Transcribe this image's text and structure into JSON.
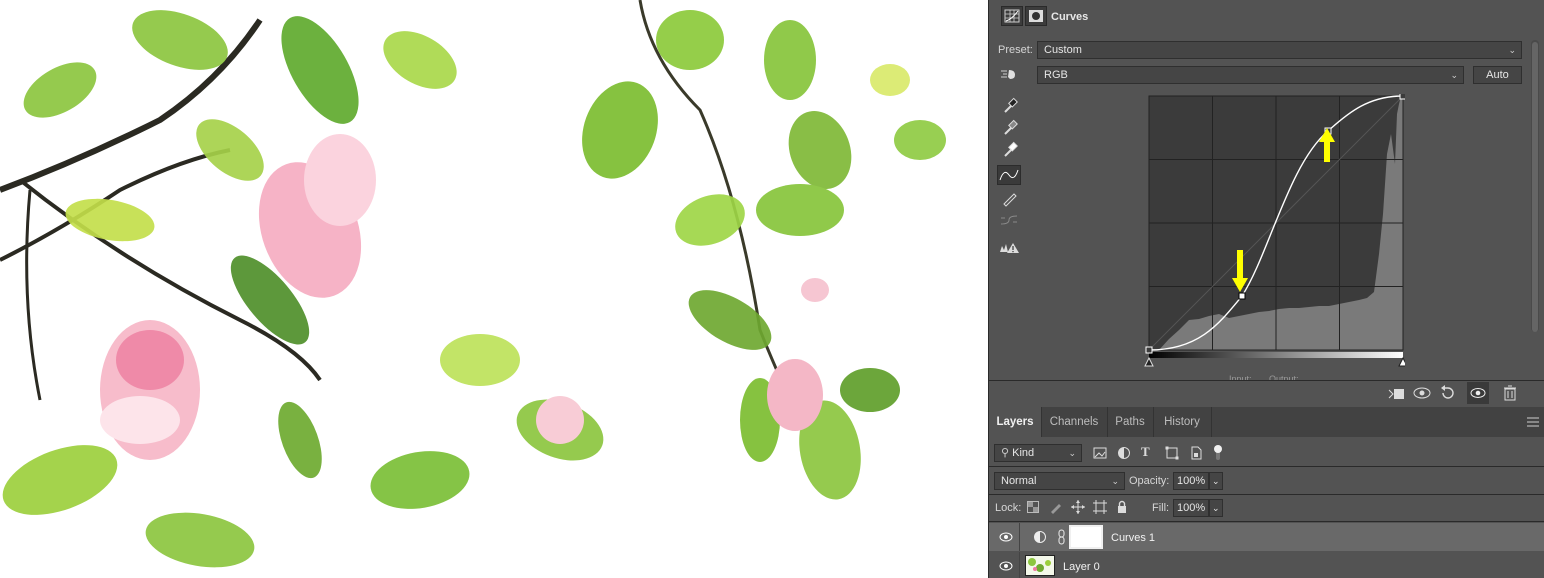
{
  "photo": {
    "subject": ""
  },
  "properties": {
    "title": "Curves",
    "preset_label": "Preset:",
    "preset_value": "Custom",
    "channel_value": "RGB",
    "auto_label": "Auto",
    "input_label": "Input:",
    "output_label": "Output:"
  },
  "tools": [
    "sample-in-image-black-icon",
    "sample-in-image-gray-icon",
    "sample-in-image-white-icon",
    "edit-points-curve-icon",
    "draw-pencil-icon",
    "smooth-curve-icon",
    "clipping-warning-icon"
  ],
  "footer_icons": [
    "clip-to-layer-icon",
    "view-previous-state-icon",
    "reset-icon",
    "visibility-icon",
    "delete-icon"
  ],
  "layers_panel": {
    "tabs": [
      {
        "label": "Layers",
        "active": true
      },
      {
        "label": "Channels",
        "active": false
      },
      {
        "label": "Paths",
        "active": false
      },
      {
        "label": "History",
        "active": false
      }
    ],
    "filter_kind": "Kind",
    "blend_mode": "Normal",
    "opacity_label": "Opacity:",
    "opacity_value": "100%",
    "lock_label": "Lock:",
    "fill_label": "Fill:",
    "fill_value": "100%",
    "layers": [
      {
        "name": "Curves 1",
        "selected": true,
        "visible": true
      },
      {
        "name": "Layer 0",
        "selected": false,
        "visible": true
      }
    ]
  },
  "colors": {
    "panel_bg": "#535353",
    "graph_bg": "#3b3b3b",
    "histogram": "#7a7a7a",
    "curve": "#ffffff",
    "annotation_arrow": "#ffff00",
    "leaf_green": "#8cc63f",
    "blossom_pink": "#f07aa0"
  }
}
